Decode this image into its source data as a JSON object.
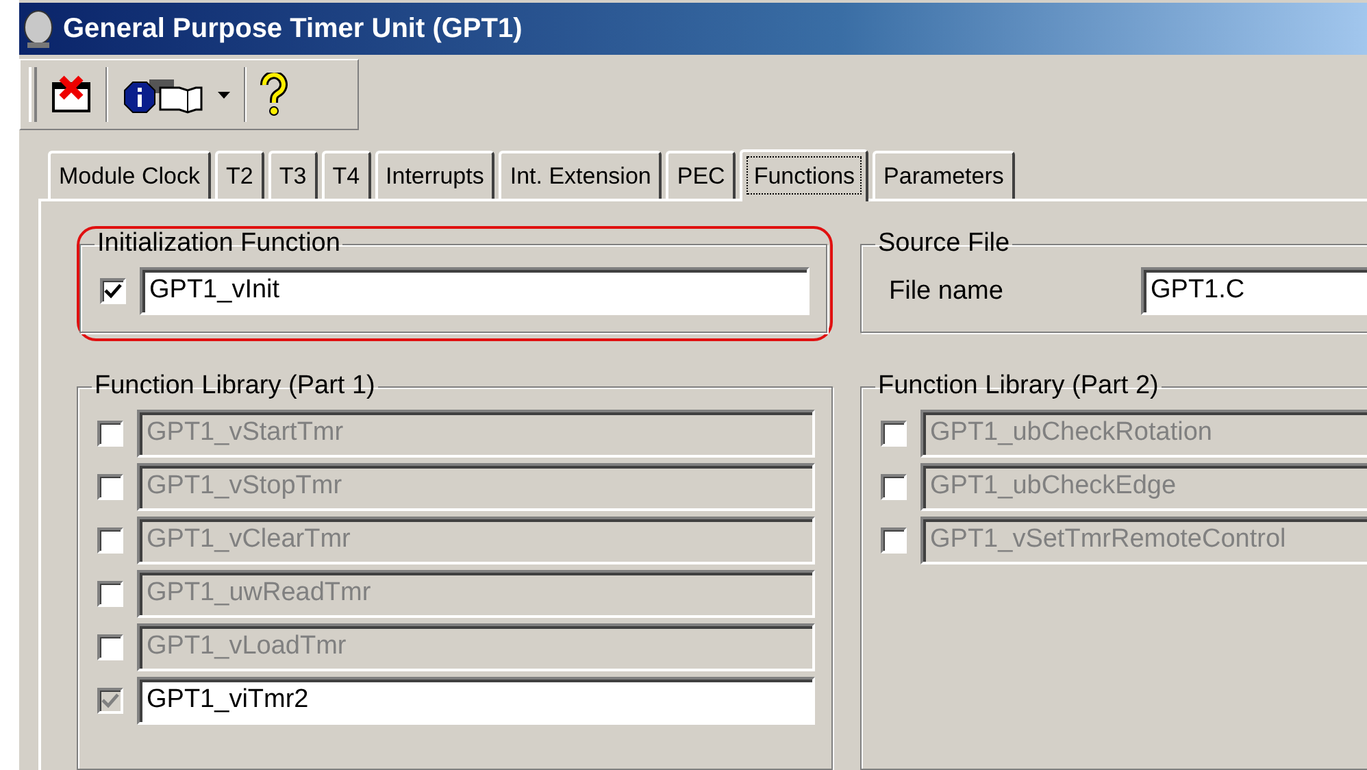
{
  "window": {
    "title": "General Purpose Timer Unit (GPT1)"
  },
  "toolbar": {
    "buttons": [
      {
        "kind": "close"
      },
      {
        "kind": "info",
        "dropdown": true
      },
      {
        "kind": "help"
      }
    ]
  },
  "tabs": [
    {
      "label": "Module Clock",
      "selected": false
    },
    {
      "label": "T2",
      "selected": false
    },
    {
      "label": "T3",
      "selected": false
    },
    {
      "label": "T4",
      "selected": false
    },
    {
      "label": "Interrupts",
      "selected": false
    },
    {
      "label": "Int. Extension",
      "selected": false
    },
    {
      "label": "PEC",
      "selected": false
    },
    {
      "label": "Functions",
      "selected": true
    },
    {
      "label": "Parameters",
      "selected": false
    }
  ],
  "init_function": {
    "title": "Initialization Function",
    "highlighted": true,
    "checked": true,
    "value": "GPT1_vInit"
  },
  "source_file": {
    "title": "Source File",
    "label": "File name",
    "value": "GPT1.C"
  },
  "library_1": {
    "title": "Function Library (Part 1)",
    "items": [
      {
        "value": "GPT1_vStartTmr",
        "checked": false,
        "checkbox_disabled": false,
        "disabled": true
      },
      {
        "value": "GPT1_vStopTmr",
        "checked": false,
        "checkbox_disabled": false,
        "disabled": true
      },
      {
        "value": "GPT1_vClearTmr",
        "checked": false,
        "checkbox_disabled": false,
        "disabled": true
      },
      {
        "value": "GPT1_uwReadTmr",
        "checked": false,
        "checkbox_disabled": false,
        "disabled": true
      },
      {
        "value": "GPT1_vLoadTmr",
        "checked": false,
        "checkbox_disabled": false,
        "disabled": true
      },
      {
        "value": "GPT1_viTmr2",
        "checked": true,
        "checkbox_disabled": true,
        "disabled": false
      }
    ]
  },
  "library_2": {
    "title": "Function Library (Part 2)",
    "items": [
      {
        "value": "GPT1_ubCheckRotation",
        "checked": false,
        "checkbox_disabled": false,
        "disabled": true
      },
      {
        "value": "GPT1_ubCheckEdge",
        "checked": false,
        "checkbox_disabled": false,
        "disabled": true
      },
      {
        "value": "GPT1_vSetTmrRemoteControl",
        "checked": false,
        "checkbox_disabled": false,
        "disabled": true
      }
    ]
  }
}
